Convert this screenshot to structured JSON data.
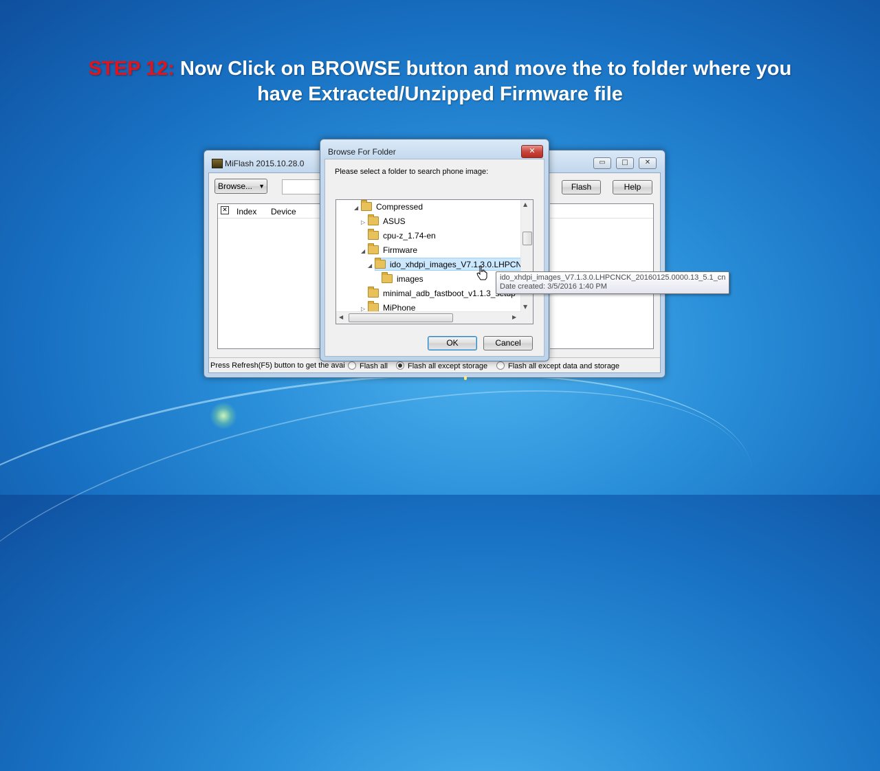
{
  "headline": {
    "step": "STEP 12:",
    "text_line1": "Now Click on BROWSE button and move the to folder where you",
    "text_line2": "have Extracted/Unzipped Firmware file"
  },
  "miflash": {
    "title": "MiFlash 2015.10.28.0",
    "browse_label": "Browse...",
    "flash_label": "Flash",
    "help_label": "Help",
    "columns": [
      "Index",
      "Device"
    ],
    "status_text": "Press Refresh(F5) button to get the avai",
    "radio_options": [
      {
        "label": "Flash all",
        "selected": false
      },
      {
        "label": "Flash all except storage",
        "selected": true
      },
      {
        "label": "Flash all except data and storage",
        "selected": false
      }
    ]
  },
  "dialog": {
    "title": "Browse For Folder",
    "prompt": "Please select a folder to search phone image:",
    "tree": [
      {
        "label": "Compressed",
        "arrow": "◢"
      },
      {
        "label": "ASUS",
        "arrow": "▷"
      },
      {
        "label": "cpu-z_1.74-en",
        "arrow": ""
      },
      {
        "label": "Firmware",
        "arrow": "◢"
      },
      {
        "label": "ido_xhdpi_images_V7.1.3.0.LHPCNC",
        "arrow": "◢"
      },
      {
        "label": "images",
        "arrow": ""
      },
      {
        "label": "minimal_adb_fastboot_v1.1.3_setup",
        "arrow": ""
      },
      {
        "label": "MiPhone",
        "arrow": "▷"
      }
    ],
    "ok_label": "OK",
    "cancel_label": "Cancel",
    "close_glyph": "✕"
  },
  "tooltip": {
    "line1": "ido_xhdpi_images_V7.1.3.0.LHPCNCK_20160125.0000.13_5.1_cn",
    "line2": "Date created: 3/5/2016 1:40 PM"
  },
  "colors": {
    "step_red": "#e0141c",
    "selection": "#cce8ff",
    "close_button": "#c9463d"
  }
}
